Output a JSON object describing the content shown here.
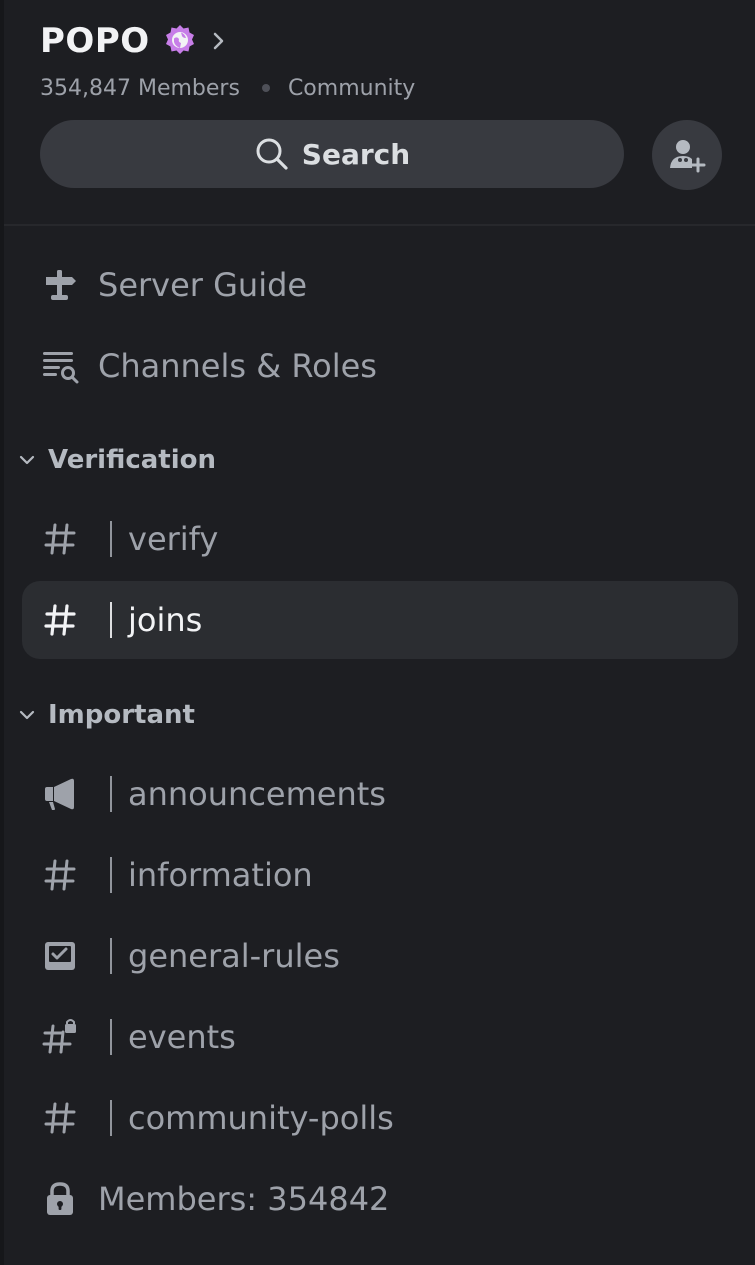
{
  "server": {
    "name": "POPO",
    "member_count": "354,847 Members",
    "tag": "Community"
  },
  "search": {
    "label": "Search"
  },
  "nav": {
    "server_guide": "Server Guide",
    "channels_roles": "Channels & Roles"
  },
  "categories": [
    {
      "name": "Verification",
      "channels": [
        {
          "name": "verify",
          "icon": "hash-icon",
          "active": false
        },
        {
          "name": "joins",
          "icon": "hash-icon",
          "active": true
        }
      ]
    },
    {
      "name": "Important",
      "channels": [
        {
          "name": "announcements",
          "icon": "megaphone-icon",
          "active": false
        },
        {
          "name": "information",
          "icon": "hash-icon",
          "active": false
        },
        {
          "name": "general-rules",
          "icon": "rules-checkbox-icon",
          "active": false
        },
        {
          "name": "events",
          "icon": "locked-hash-icon",
          "active": false
        },
        {
          "name": "community-polls",
          "icon": "hash-icon",
          "active": false
        }
      ]
    }
  ],
  "members_channel": {
    "label": "Members: 354842",
    "icon": "lock-icon"
  },
  "colors": {
    "background": "#1d1e22",
    "active_row": "#2b2d31",
    "search_bg": "#383a40",
    "badge_pink": "#c77ee8",
    "text_muted": "#9ea2aa",
    "text_bright": "#f2f3f5"
  }
}
